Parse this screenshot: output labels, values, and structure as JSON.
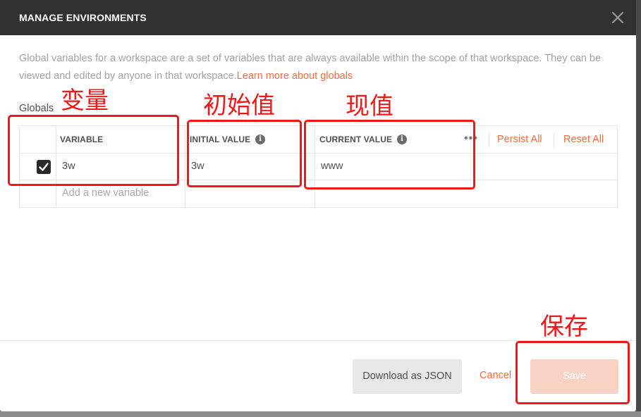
{
  "modal": {
    "title": "MANAGE ENVIRONMENTS",
    "description": "Global variables for a workspace are a set of variables that are always available within the scope of that workspace. They can be viewed and edited by anyone in that workspace.",
    "learn_more_link": "Learn more about globals",
    "section_label": "Globals"
  },
  "table": {
    "headers": {
      "variable": "VARIABLE",
      "initial_value": "INITIAL VALUE",
      "current_value": "CURRENT VALUE",
      "info_glyph": "i",
      "more_glyph": "•••"
    },
    "actions": {
      "persist_all": "Persist All",
      "reset_all": "Reset All"
    },
    "rows": [
      {
        "checked": true,
        "variable": "3w",
        "initial_value": "3w",
        "current_value": "www"
      }
    ],
    "new_variable_placeholder": "Add a new variable"
  },
  "footer": {
    "download_label": "Download as JSON",
    "cancel_label": "Cancel",
    "save_label": "Save"
  },
  "annotations": {
    "variable": "变量",
    "initial_value": "初始值",
    "current_value": "现值",
    "save": "保存"
  },
  "colors": {
    "accent": "#f26b3a",
    "header_bg": "#303030",
    "annotation": "#f21818",
    "save_disabled": "#fad2c3"
  },
  "icons": {
    "close": "close-icon",
    "info": "info-icon",
    "more": "more-horizontal-icon",
    "checkbox": "checkmark-icon"
  }
}
